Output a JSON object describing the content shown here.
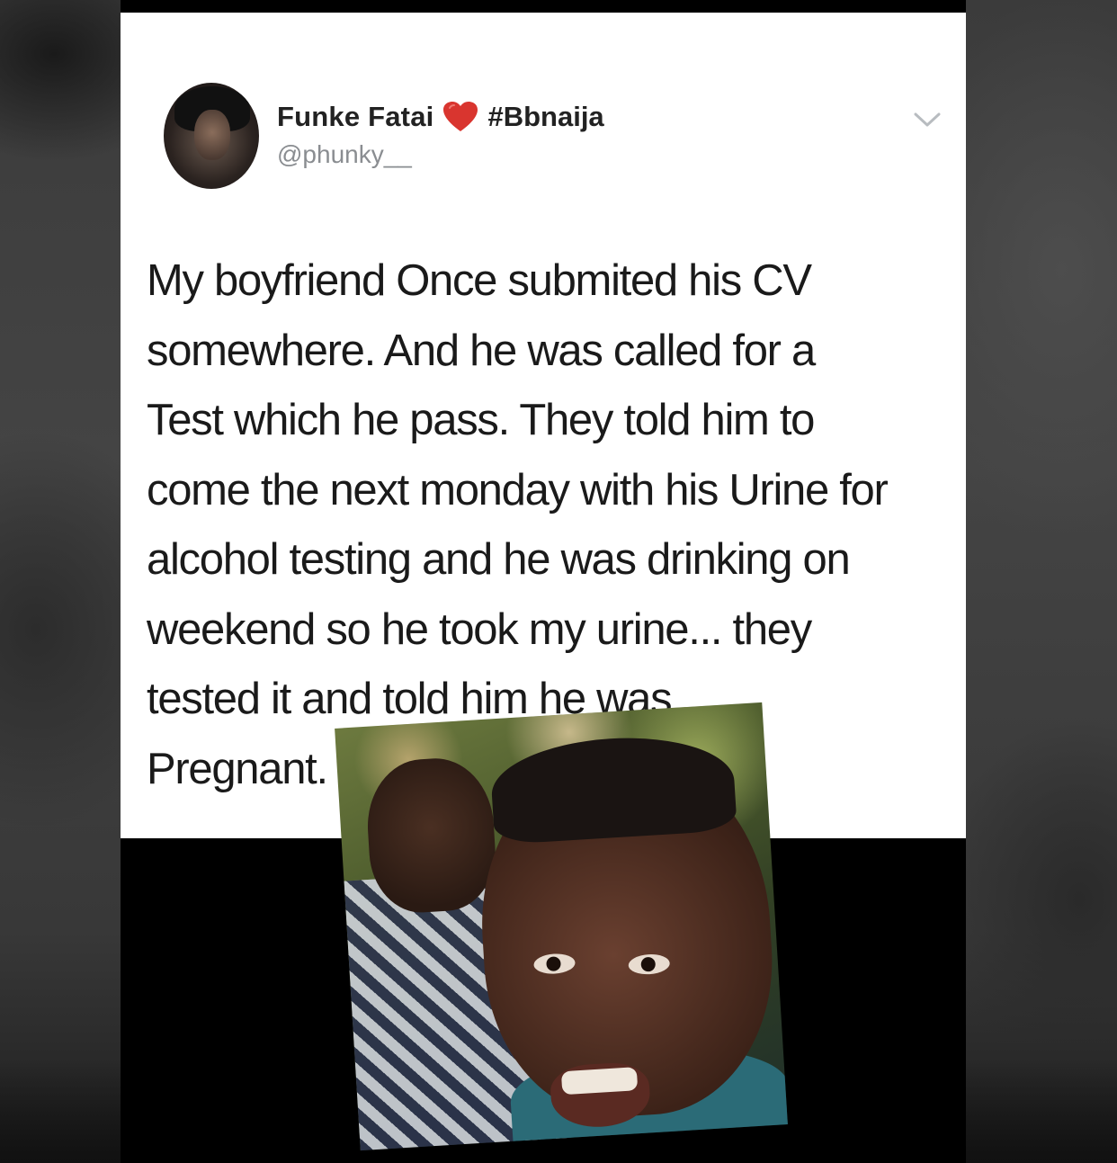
{
  "tweet": {
    "display_name": "Funke Fatai",
    "name_emoji": "heart-icon",
    "hashtag": "#Bbnaija",
    "handle": "@phunky__",
    "text_lines": [
      "My boyfriend Once submited his CV",
      "somewhere. And he was called for a",
      "Test which he pass. They told him to",
      "come the next monday with his Urine for",
      "alcohol testing and he was drinking on",
      "weekend so he took my urine... they",
      "tested it and told him he was",
      "Pregnant."
    ],
    "menu_icon": "chevron-down-icon"
  },
  "colors": {
    "heart": "#d9352f",
    "text": "#1a1a1a",
    "handle": "#8a8d91",
    "card_background": "#ffffff"
  },
  "overlay": {
    "image": "reaction-meme-photo"
  }
}
